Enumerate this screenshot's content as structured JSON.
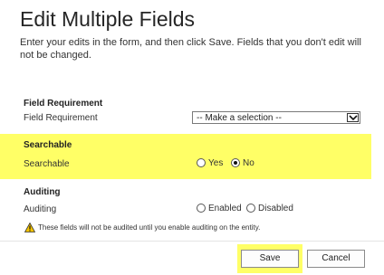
{
  "dialog": {
    "title": "Edit Multiple Fields",
    "intro": "Enter your edits in the form, and then click Save. Fields that you don't edit will not be changed."
  },
  "field_requirement": {
    "section_title": "Field Requirement",
    "label": "Field Requirement",
    "select_value": "-- Make a selection --"
  },
  "searchable": {
    "section_title": "Searchable",
    "label": "Searchable",
    "options": [
      "Yes",
      "No"
    ],
    "selected": "No",
    "highlight_color": "#ffff66"
  },
  "auditing": {
    "section_title": "Auditing",
    "label": "Auditing",
    "options": [
      "Enabled",
      "Disabled"
    ],
    "selected": null,
    "warning": "These fields will not be audited until you enable auditing on the entity.",
    "warning_icon": "warning-triangle-icon"
  },
  "footer": {
    "save_label": "Save",
    "cancel_label": "Cancel"
  }
}
